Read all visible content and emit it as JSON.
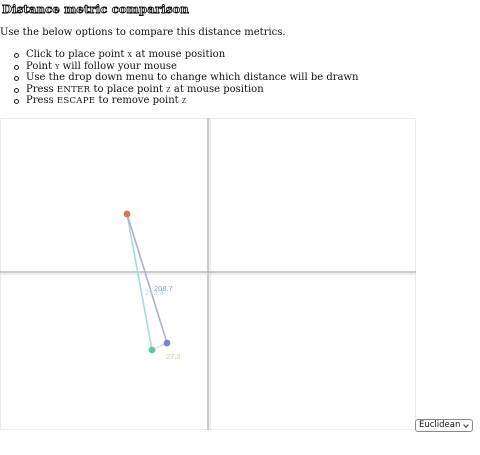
{
  "page": {
    "title": "Distance metric comparison",
    "intro": "Use the below options to compare this distance metrics."
  },
  "instructions": {
    "click_pre": "Click to place point ",
    "click_var": "x",
    "click_post": " at mouse position",
    "follow_pre": "Point ",
    "follow_var": "y",
    "follow_post": " will follow your mouse",
    "dropdown": "Use the drop down menu to change which distance will be drawn",
    "enter_pre": "Press ",
    "enter_key": "ENTER",
    "enter_mid": " to place point ",
    "enter_var": "z",
    "enter_post": " at mouse position",
    "escape_pre": "Press ",
    "escape_key": "ESCAPE",
    "escape_mid": " to remove point ",
    "escape_var": "z"
  },
  "canvas": {
    "labels": {
      "xy_distance": "208.7",
      "xz_distance": "212.4",
      "yz_distance": "27.3"
    },
    "colors": {
      "point_x": "#e0704f",
      "point_y": "#7d80d6",
      "point_z": "#5ec99f",
      "line_xy": "#b0b0cc",
      "line_xz": "#9fdde4",
      "line_yz": "#dddddd",
      "label_xy": "#8e98cc",
      "label_xz": "#a7d6e0",
      "label_yz": "#e3c59a"
    }
  },
  "metric_select": {
    "selected": "Euclidean"
  }
}
